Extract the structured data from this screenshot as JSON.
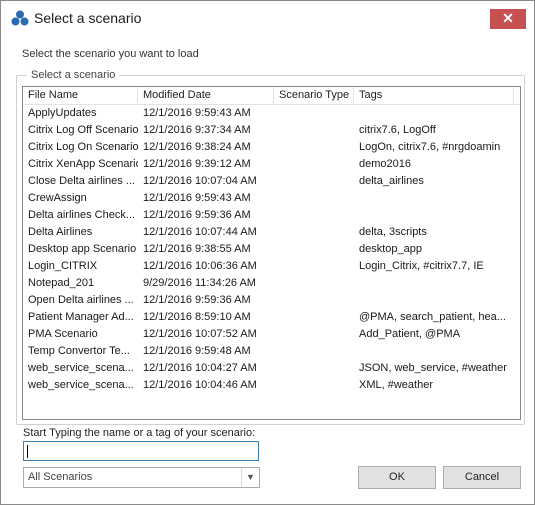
{
  "window": {
    "title": "Select a scenario",
    "close_label": "✕"
  },
  "instruction": "Select the scenario you want to load",
  "group_title": "Select a scenario",
  "columns": [
    "File Name",
    "Modified Date",
    "Scenario Type",
    "Tags"
  ],
  "rows": [
    {
      "name": "ApplyUpdates",
      "date": "12/1/2016 9:59:43 AM",
      "type": "",
      "tags": ""
    },
    {
      "name": "Citrix Log Off Scenario",
      "date": "12/1/2016 9:37:34 AM",
      "type": "",
      "tags": "citrix7.6, LogOff"
    },
    {
      "name": "Citrix Log On Scenario",
      "date": "12/1/2016 9:38:24 AM",
      "type": "",
      "tags": "LogOn, citrix7.6, #nrgdoamin"
    },
    {
      "name": "Citrix XenApp Scenario",
      "date": "12/1/2016 9:39:12 AM",
      "type": "",
      "tags": "demo2016"
    },
    {
      "name": "Close Delta airlines ...",
      "date": "12/1/2016 10:07:04 AM",
      "type": "",
      "tags": "delta_airlines"
    },
    {
      "name": "CrewAssign",
      "date": "12/1/2016 9:59:43 AM",
      "type": "",
      "tags": ""
    },
    {
      "name": "Delta airlines Check...",
      "date": "12/1/2016 9:59:36 AM",
      "type": "",
      "tags": ""
    },
    {
      "name": "Delta Airlines",
      "date": "12/1/2016 10:07:44 AM",
      "type": "",
      "tags": "delta, 3scripts"
    },
    {
      "name": "Desktop app Scenario",
      "date": "12/1/2016 9:38:55 AM",
      "type": "",
      "tags": "desktop_app"
    },
    {
      "name": "Login_CITRIX",
      "date": "12/1/2016 10:06:36 AM",
      "type": "",
      "tags": "Login_Citrix, #citrix7.7, IE"
    },
    {
      "name": "Notepad_201",
      "date": "9/29/2016 11:34:26 AM",
      "type": "",
      "tags": ""
    },
    {
      "name": "Open Delta airlines ...",
      "date": "12/1/2016 9:59:36 AM",
      "type": "",
      "tags": ""
    },
    {
      "name": "Patient Manager Ad...",
      "date": "12/1/2016 8:59:10 AM",
      "type": "",
      "tags": "@PMA, search_patient, hea..."
    },
    {
      "name": "PMA Scenario",
      "date": "12/1/2016 10:07:52 AM",
      "type": "",
      "tags": "Add_Patient, @PMA"
    },
    {
      "name": "Temp Convertor Te...",
      "date": "12/1/2016 9:59:48 AM",
      "type": "",
      "tags": ""
    },
    {
      "name": "web_service_scena...",
      "date": "12/1/2016 10:04:27 AM",
      "type": "",
      "tags": "JSON, web_service, #weather"
    },
    {
      "name": "web_service_scena...",
      "date": "12/1/2016 10:04:46 AM",
      "type": "",
      "tags": "XML, #weather"
    }
  ],
  "search": {
    "label": "Start Typing the name or a tag of your scenario:",
    "value": ""
  },
  "filter": {
    "selected": "All Scenarios"
  },
  "buttons": {
    "ok": "OK",
    "cancel": "Cancel"
  },
  "colors": {
    "close_button": "#c75050",
    "icon": "#2b6cb0",
    "input_border": "#3c7fb1"
  }
}
